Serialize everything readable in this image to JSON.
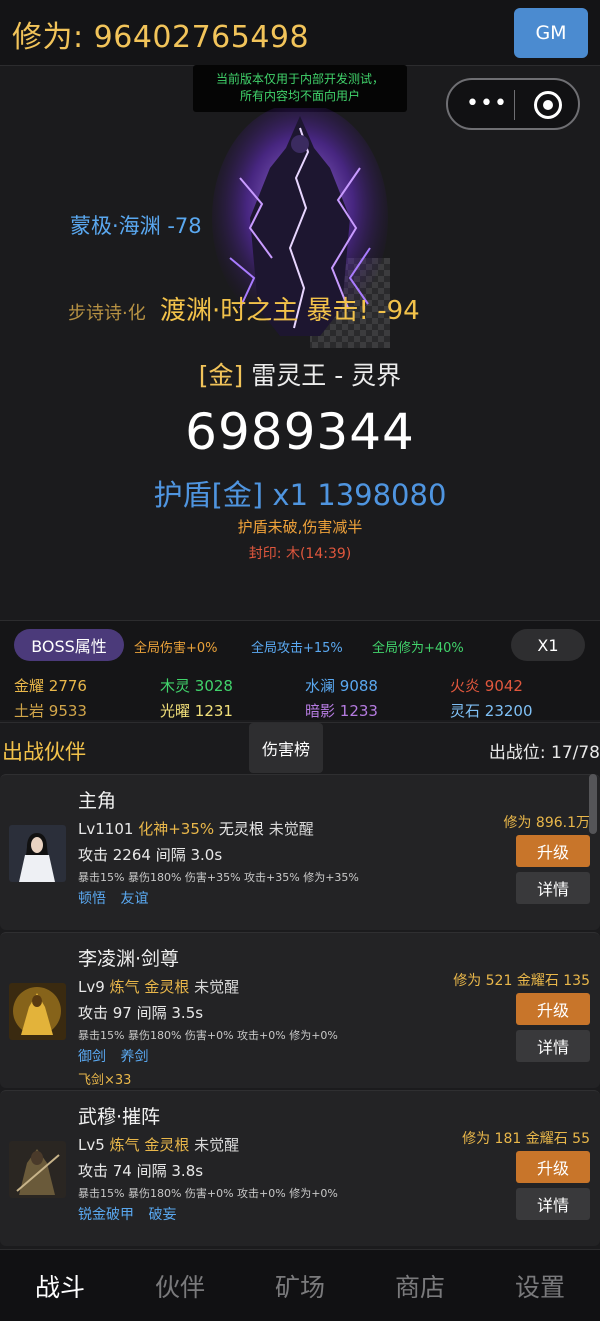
{
  "header": {
    "cultivation_label": "修为: 96402765498",
    "gm_label": "GM"
  },
  "dev_banner": {
    "line1": "当前版本仅用于内部开发测试，",
    "line2": "所有内容均不面向用户"
  },
  "capsule": {
    "menu_glyph": "•••",
    "close_icon": "target-icon"
  },
  "battle": {
    "floating_texts": [
      {
        "text": "蒙极·海渊 -78",
        "color": "#5aa8f0"
      },
      {
        "text": "步诗诗·化",
        "color": "#d2a64a"
      },
      {
        "text": "渡渊·时之主 暴击! -94",
        "color": "#f2c24a"
      }
    ],
    "boss_tier": "[金]",
    "boss_name": "雷灵王 - 灵界",
    "boss_hp": "6989344",
    "shield_text": "护盾[金] x1  1398080",
    "shield_note": "护盾未破,伤害减半",
    "seal_note": "封印: 木(14:39)"
  },
  "attributes": {
    "boss_attr_label": "BOSS属性",
    "buffs": [
      "全局伤害+0%",
      "全局攻击+15%",
      "全局修为+40%"
    ],
    "speed_label": "X1",
    "resources": [
      {
        "name": "金耀",
        "value": "2776",
        "color": "#e9b74a"
      },
      {
        "name": "木灵",
        "value": "3028",
        "color": "#41d36b"
      },
      {
        "name": "水澜",
        "value": "9088",
        "color": "#5aa8f0"
      },
      {
        "name": "火炎",
        "value": "9042",
        "color": "#e0573d"
      },
      {
        "name": "土岩",
        "value": "9533",
        "color": "#d2a64a"
      },
      {
        "name": "光曜",
        "value": "1231",
        "color": "#f2e07a"
      },
      {
        "name": "暗影",
        "value": "1233",
        "color": "#b57be0"
      },
      {
        "name": "灵石",
        "value": "23200",
        "color": "#7fc0f5"
      }
    ]
  },
  "partners": {
    "title": "出战伙伴",
    "ranking_label": "伤害榜",
    "slot_info": "出战位: 17/78",
    "upgrade_label": "升级",
    "detail_label": "详情",
    "items": [
      {
        "name": "主角",
        "level": "Lv1101",
        "realm": "化神+35%",
        "root": "无灵根",
        "awaken": "未觉醒",
        "attack": "攻击 2264  间隔 3.0s",
        "bonus": "暴击15% 暴伤180% 伤害+35% 攻击+35% 修为+35%",
        "skills": [
          "顿悟",
          "友谊"
        ],
        "extra": "",
        "cost": "修为 896.1万"
      },
      {
        "name": "李凌渊·剑尊",
        "level": "Lv9",
        "realm": "炼气",
        "root": "金灵根",
        "awaken": "未觉醒",
        "attack": "攻击 97  间隔 3.5s",
        "bonus": "暴击15% 暴伤180% 伤害+0% 攻击+0% 修为+0%",
        "skills": [
          "御剑",
          "养剑"
        ],
        "extra": "飞剑×33",
        "cost": "修为 521  金耀石 135"
      },
      {
        "name": "武穆·摧阵",
        "level": "Lv5",
        "realm": "炼气",
        "root": "金灵根",
        "awaken": "未觉醒",
        "attack": "攻击 74  间隔 3.8s",
        "bonus": "暴击15% 暴伤180% 伤害+0% 攻击+0% 修为+0%",
        "skills": [
          "锐金破甲",
          "破妄"
        ],
        "extra": "",
        "cost": "修为 181  金耀石 55"
      }
    ]
  },
  "nav": {
    "items": [
      "战斗",
      "伙伴",
      "矿场",
      "商店",
      "设置"
    ],
    "active": "战斗"
  }
}
